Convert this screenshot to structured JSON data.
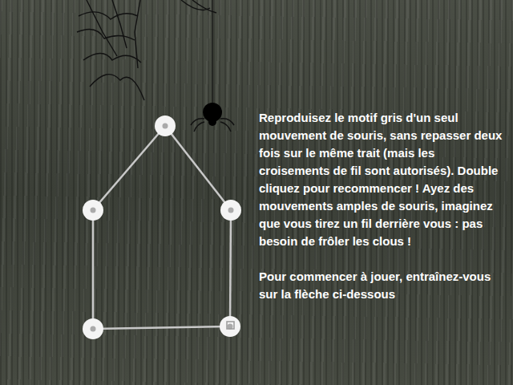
{
  "instructions": [
    "Reproduisez le motif gris d'un seul mouvement de souris, sans repasser deux fois sur le même trait (mais les croisements de fil sont autorisés). Double cliquez pour recommencer ! Ayez des mouvements amples de souris, imaginez que vous tirez un fil derrière vous : pas besoin de frôler les clous !",
    "Pour commencer à jouer, entraînez-vous sur la flèche ci-dessous"
  ],
  "pattern": {
    "nails": [
      {
        "start": false
      },
      {
        "start": false
      },
      {
        "start": false
      },
      {
        "start": false
      },
      {
        "start": true
      }
    ]
  }
}
